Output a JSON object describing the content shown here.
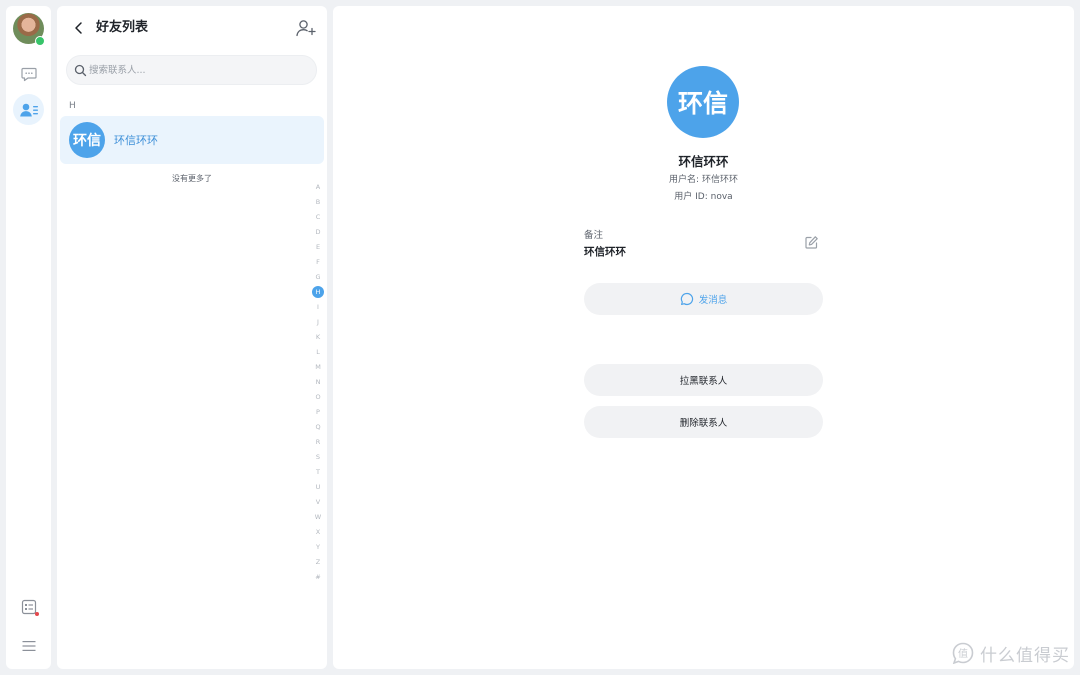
{
  "nav": {
    "items": [
      {
        "name": "chat",
        "icon": "chat-bubble-icon",
        "active": false
      },
      {
        "name": "contacts",
        "icon": "contacts-icon",
        "active": true
      }
    ],
    "bottom": [
      {
        "name": "notifications",
        "icon": "notice-icon",
        "badge": true
      },
      {
        "name": "menu",
        "icon": "menu-icon"
      }
    ]
  },
  "list": {
    "title": "好友列表",
    "search_placeholder": "搜索联系人...",
    "section": "H",
    "contacts": [
      {
        "avatar_text": "环信",
        "name": "环信环环",
        "selected": true
      }
    ],
    "no_more": "没有更多了",
    "alphabet": [
      "A",
      "B",
      "C",
      "D",
      "E",
      "F",
      "G",
      "H",
      "I",
      "J",
      "K",
      "L",
      "M",
      "N",
      "O",
      "P",
      "Q",
      "R",
      "S",
      "T",
      "U",
      "V",
      "W",
      "X",
      "Y",
      "Z",
      "#"
    ],
    "alphabet_active": "H"
  },
  "detail": {
    "avatar_text": "环信",
    "name": "环信环环",
    "username_line": "用户名: 环信环环",
    "userid_line": "用户 ID: nova",
    "remark_label": "备注",
    "remark_value": "环信环环",
    "send_message": "发消息",
    "block_contact": "拉黑联系人",
    "delete_contact": "删除联系人"
  },
  "watermark": {
    "text": "什么值得买",
    "logo_char": "值"
  },
  "colors": {
    "accent": "#4da3ea",
    "online": "#37c46a",
    "selected_row": "#eaf4fd"
  }
}
